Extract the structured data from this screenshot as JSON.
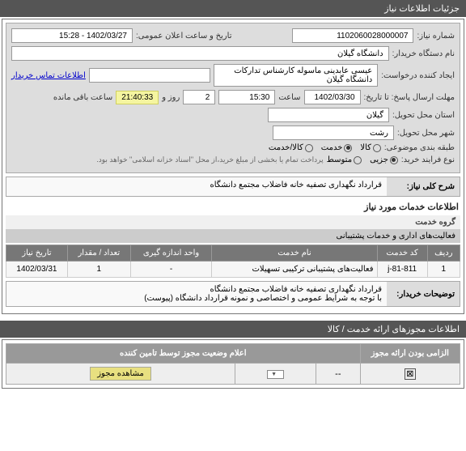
{
  "header": {
    "title": "جزئیات اطلاعات نیاز"
  },
  "form": {
    "need_no_label": "شماره نیاز:",
    "need_no": "1102060028000007",
    "announce_label": "تاریخ و ساعت اعلان عمومی:",
    "announce": "1402/03/27 - 15:28",
    "buyer_label": "نام دستگاه خریدار:",
    "buyer": "دانشگاه گیلان",
    "requester_label": "ایجاد کننده درخواست:",
    "requester": "عیسی عابدینی ماسوله کارشناس تدارکات دانشگاه گیلان",
    "contact_link": "اطلاعات تماس خریدار",
    "deadline_label": "مهلت ارسال پاسخ: تا تاریخ:",
    "deadline_date": "1402/03/30",
    "time_label": "ساعت",
    "deadline_time": "15:30",
    "days": "2",
    "days_label": "روز و",
    "remaining": "21:40:33",
    "remaining_label": "ساعت باقی مانده",
    "province_label": "استان محل تحویل:",
    "province": "گیلان",
    "city_label": "شهر محل تحویل:",
    "city": "رشت",
    "category_label": "طبقه بندی موضوعی:",
    "cat_kala": "کالا",
    "cat_khedmat": "خدمت",
    "cat_both": "کالا/خدمت",
    "process_label": "نوع فرایند خرید:",
    "proc_small": "جزیی",
    "proc_med": "متوسط",
    "pay_note": "پرداخت تمام یا بخشی از مبلغ خرید،از محل \"اسناد خزانه اسلامی\" خواهد بود."
  },
  "desc": {
    "main_label": "شرح کلی نیاز:",
    "main_text": "قرارداد نگهداری تصفیه خانه فاضلاب مجتمع دانشگاه",
    "section_title": "اطلاعات خدمات مورد نیاز",
    "group_label": "گروه خدمت",
    "group_val": "فعالیت‌های اداری و خدمات پشتیبانی",
    "explain_label": "توضیحات خریدار:",
    "explain_text_1": "قرارداد نگهداری تصفیه خانه فاضلاب مجتمع دانشگاه",
    "explain_text_2": "با توجه به شرایط عمومی و اختصاصی و نمونه قرارداد دانشگاه (پیوست)"
  },
  "table": {
    "headers": {
      "row": "ردیف",
      "code": "کد خدمت",
      "name": "نام خدمت",
      "unit": "واحد اندازه گیری",
      "qty": "تعداد / مقدار",
      "date": "تاریخ نیاز"
    },
    "rows": [
      {
        "row": "1",
        "code": "j-81-811",
        "name": "فعالیت‌های پشتیبانی ترکیبی تسهیلات",
        "unit": "-",
        "qty": "1",
        "date": "1402/03/31"
      }
    ]
  },
  "perm": {
    "header": "اطلاعات مجوزهای ارائه خدمت / کالا",
    "col_required": "الزامی بودن ارائه مجوز",
    "col_status": "اعلام وضعیت مجوز توسط تامین کننده",
    "checked": "⊠",
    "dash": "--",
    "dd_empty": "",
    "btn_view": "مشاهده مجوز"
  }
}
